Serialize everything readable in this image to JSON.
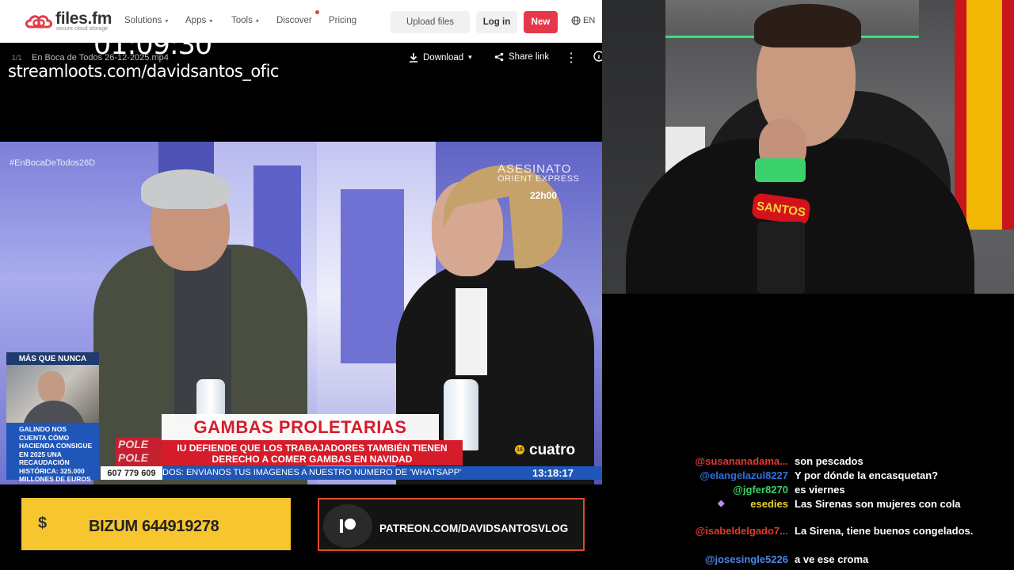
{
  "nav": {
    "logo_text": "files.fm",
    "logo_sub": "secure cloud storage",
    "items": [
      {
        "label": "Solutions",
        "has_dropdown": true
      },
      {
        "label": "Apps",
        "has_dropdown": true
      },
      {
        "label": "Tools",
        "has_dropdown": true
      },
      {
        "label": "Discover",
        "has_dropdown": false
      },
      {
        "label": "Pricing",
        "has_dropdown": false
      }
    ],
    "upload_label": "Upload files",
    "login_label": "Log in",
    "new_label": "New",
    "lang_label": "EN",
    "brand_color": "#e53949"
  },
  "overlay": {
    "timer": "01:09:30",
    "streamloots": "streamloots.com/davidsantos_ofic"
  },
  "player": {
    "file_count": "1/1",
    "file_name": "En Boca de Todos 26-12-2025.mp4",
    "download_label": "Download",
    "share_label": "Share link"
  },
  "tv": {
    "hashtag": "#EnBocaDeTodos26D",
    "promo_title": "ASESINATO",
    "promo_subtitle": "ORIENT EXPRESS",
    "promo_time": "22h00",
    "pip_title": "MÁS QUE NUNCA",
    "pip_caption": "GALINDO NOS CUENTA CÓMO HACIENDA CONSIGUE EN 2025 UNA RECAUDACIÓN HISTÓRICA: 325.000 MILLONES DE EUROS",
    "pole_text": "POLE POLE",
    "headline": "GAMBAS PROLETARIAS",
    "subheadline": "IU DEFIENDE QUE LOS TRABAJADORES TAMBIÉN TIENEN DERECHO A COMER GAMBAS EN NAVIDAD",
    "channel": "cuatro",
    "channel_badge": "16",
    "phone": "607 779 609",
    "ticker": "DOS: ENVIANOS TUS IMÁGENES A NUESTRO NÚMERO DE 'WHATSAPP'",
    "clock": "13:18:17"
  },
  "banners": {
    "bizum_icon": "$",
    "bizum_text": "BIZUM 644919278",
    "patreon_text": "PATREON.COM/DAVIDSANTOSVLOG"
  },
  "webcam": {
    "mic_label": "SANTOS"
  },
  "chat": [
    {
      "user": "@susananadama...",
      "color": "#e0392b",
      "message": "son pescados"
    },
    {
      "user": "@elangelazul8227",
      "color": "#2f6fe0",
      "message": "Y por dónde la encasquetan?"
    },
    {
      "user": "@jgfer8270",
      "color": "#3ad16a",
      "message": "es viernes"
    },
    {
      "user": "esedies",
      "color": "#e8d232",
      "message": "Las Sirenas son mujeres con cola"
    },
    {
      "user": "@isabeldelgado7...",
      "color": "#e0392b",
      "message": "La Sirena, tiene buenos congelados."
    },
    {
      "user": "@josesingle5226",
      "color": "#4a86e8",
      "message": "a ve ese croma"
    }
  ]
}
